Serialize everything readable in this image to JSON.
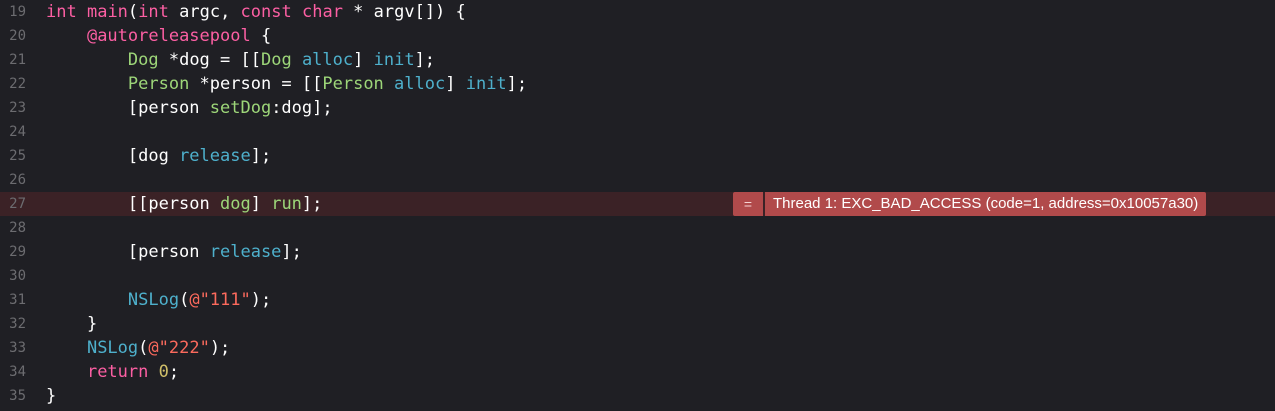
{
  "lines": [
    {
      "number": "19",
      "tokens": [
        {
          "t": "int",
          "c": "kw"
        },
        {
          "t": " ",
          "c": "plain"
        },
        {
          "t": "main",
          "c": "kw"
        },
        {
          "t": "(",
          "c": "plain"
        },
        {
          "t": "int",
          "c": "kw"
        },
        {
          "t": " argc, ",
          "c": "plain"
        },
        {
          "t": "const",
          "c": "kw"
        },
        {
          "t": " ",
          "c": "plain"
        },
        {
          "t": "char",
          "c": "kw"
        },
        {
          "t": " * argv[]) {",
          "c": "plain"
        }
      ]
    },
    {
      "number": "20",
      "tokens": [
        {
          "t": "    ",
          "c": "plain"
        },
        {
          "t": "@autoreleasepool",
          "c": "kw"
        },
        {
          "t": " {",
          "c": "plain"
        }
      ]
    },
    {
      "number": "21",
      "tokens": [
        {
          "t": "        ",
          "c": "plain"
        },
        {
          "t": "Dog",
          "c": "own"
        },
        {
          "t": " *dog = [[",
          "c": "plain"
        },
        {
          "t": "Dog",
          "c": "own"
        },
        {
          "t": " ",
          "c": "plain"
        },
        {
          "t": "alloc",
          "c": "mth"
        },
        {
          "t": "] ",
          "c": "plain"
        },
        {
          "t": "init",
          "c": "mth"
        },
        {
          "t": "];",
          "c": "plain"
        }
      ]
    },
    {
      "number": "22",
      "tokens": [
        {
          "t": "        ",
          "c": "plain"
        },
        {
          "t": "Person",
          "c": "own"
        },
        {
          "t": " *person = [[",
          "c": "plain"
        },
        {
          "t": "Person",
          "c": "own"
        },
        {
          "t": " ",
          "c": "plain"
        },
        {
          "t": "alloc",
          "c": "mth"
        },
        {
          "t": "] ",
          "c": "plain"
        },
        {
          "t": "init",
          "c": "mth"
        },
        {
          "t": "];",
          "c": "plain"
        }
      ]
    },
    {
      "number": "23",
      "tokens": [
        {
          "t": "        [person ",
          "c": "plain"
        },
        {
          "t": "setDog",
          "c": "own"
        },
        {
          "t": ":dog];",
          "c": "plain"
        }
      ]
    },
    {
      "number": "24",
      "tokens": []
    },
    {
      "number": "25",
      "tokens": [
        {
          "t": "        [dog ",
          "c": "plain"
        },
        {
          "t": "release",
          "c": "mth"
        },
        {
          "t": "];",
          "c": "plain"
        }
      ]
    },
    {
      "number": "26",
      "tokens": []
    },
    {
      "number": "27",
      "error": true,
      "tokens": [
        {
          "t": "        [[person ",
          "c": "plain"
        },
        {
          "t": "dog",
          "c": "own"
        },
        {
          "t": "] ",
          "c": "plain"
        },
        {
          "t": "run",
          "c": "own"
        },
        {
          "t": "];",
          "c": "plain"
        }
      ]
    },
    {
      "number": "28",
      "tokens": []
    },
    {
      "number": "29",
      "tokens": [
        {
          "t": "        [person ",
          "c": "plain"
        },
        {
          "t": "release",
          "c": "mth"
        },
        {
          "t": "];",
          "c": "plain"
        }
      ]
    },
    {
      "number": "30",
      "tokens": []
    },
    {
      "number": "31",
      "tokens": [
        {
          "t": "        ",
          "c": "plain"
        },
        {
          "t": "NSLog",
          "c": "mth"
        },
        {
          "t": "(",
          "c": "plain"
        },
        {
          "t": "@\"111\"",
          "c": "str"
        },
        {
          "t": ");",
          "c": "plain"
        }
      ]
    },
    {
      "number": "32",
      "tokens": [
        {
          "t": "    }",
          "c": "plain"
        }
      ]
    },
    {
      "number": "33",
      "tokens": [
        {
          "t": "    ",
          "c": "plain"
        },
        {
          "t": "NSLog",
          "c": "mth"
        },
        {
          "t": "(",
          "c": "plain"
        },
        {
          "t": "@\"222\"",
          "c": "str"
        },
        {
          "t": ");",
          "c": "plain"
        }
      ]
    },
    {
      "number": "34",
      "tokens": [
        {
          "t": "    ",
          "c": "plain"
        },
        {
          "t": "return",
          "c": "kw"
        },
        {
          "t": " ",
          "c": "plain"
        },
        {
          "t": "0",
          "c": "num"
        },
        {
          "t": ";",
          "c": "plain"
        }
      ]
    },
    {
      "number": "35",
      "tokens": [
        {
          "t": "}",
          "c": "plain"
        }
      ]
    }
  ],
  "error_badge": {
    "icon": "=",
    "message": "Thread 1: EXC_BAD_ACCESS (code=1, address=0x10057a30)"
  },
  "colors": {
    "background": "#1f1f24",
    "error_line": "#3b2226",
    "error_badge": "#b14a4b",
    "keyword": "#fc5fa3",
    "method": "#4eb0cc",
    "own_symbol": "#9dd679",
    "string": "#fc6a5d",
    "number": "#d0bf69",
    "line_number": "#6c6c70"
  }
}
